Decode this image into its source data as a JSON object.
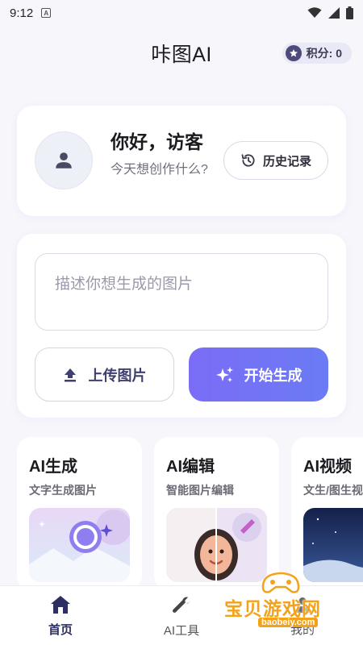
{
  "status_bar": {
    "time": "9:12",
    "notif_glyph": "A"
  },
  "header": {
    "title": "咔图AI",
    "points_label": "积分: 0"
  },
  "welcome": {
    "greeting": "你好，访客",
    "subtitle": "今天想创作什么?",
    "history_button": "历史记录"
  },
  "generator": {
    "prompt_placeholder": "描述你想生成的图片",
    "upload_button": "上传图片",
    "start_button": "开始生成"
  },
  "tools": [
    {
      "title": "AI生成",
      "subtitle": "文字生成图片"
    },
    {
      "title": "AI编辑",
      "subtitle": "智能图片编辑"
    },
    {
      "title": "AI视频",
      "subtitle": "文生/图生视频"
    }
  ],
  "nav": [
    {
      "label": "首页",
      "icon": "home-icon"
    },
    {
      "label": "AI工具",
      "icon": "wrench-icon"
    },
    {
      "label": "我的",
      "icon": "person-icon"
    }
  ],
  "watermark": {
    "text": "宝贝游戏网",
    "url": "baobeiy.com"
  },
  "colors": {
    "accent": "#7b6cf6",
    "nav_active": "#2d2f63",
    "watermark": "#f3a21a"
  }
}
